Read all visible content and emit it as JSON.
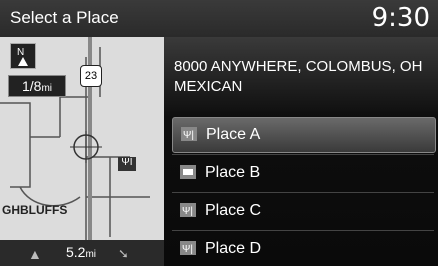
{
  "header": {
    "title": "Select a Place",
    "time": "9:30"
  },
  "map": {
    "scale_label": "1/8",
    "scale_unit": "mi",
    "route_shield": "23",
    "city_label": "GHBLUFFS",
    "distance_label": "5.2",
    "distance_unit": "mi",
    "north_icon": "north-up-icon"
  },
  "details": {
    "address": "8000 ANYWHERE, COLOMBUS, OH",
    "category": "MEXICAN"
  },
  "places": [
    {
      "label": "Place A",
      "icon": "restaurant-icon",
      "selected": true
    },
    {
      "label": "Place B",
      "icon": "atm-icon",
      "selected": false
    },
    {
      "label": "Place C",
      "icon": "restaurant-icon",
      "selected": false
    },
    {
      "label": "Place D",
      "icon": "restaurant-icon",
      "selected": false
    }
  ]
}
